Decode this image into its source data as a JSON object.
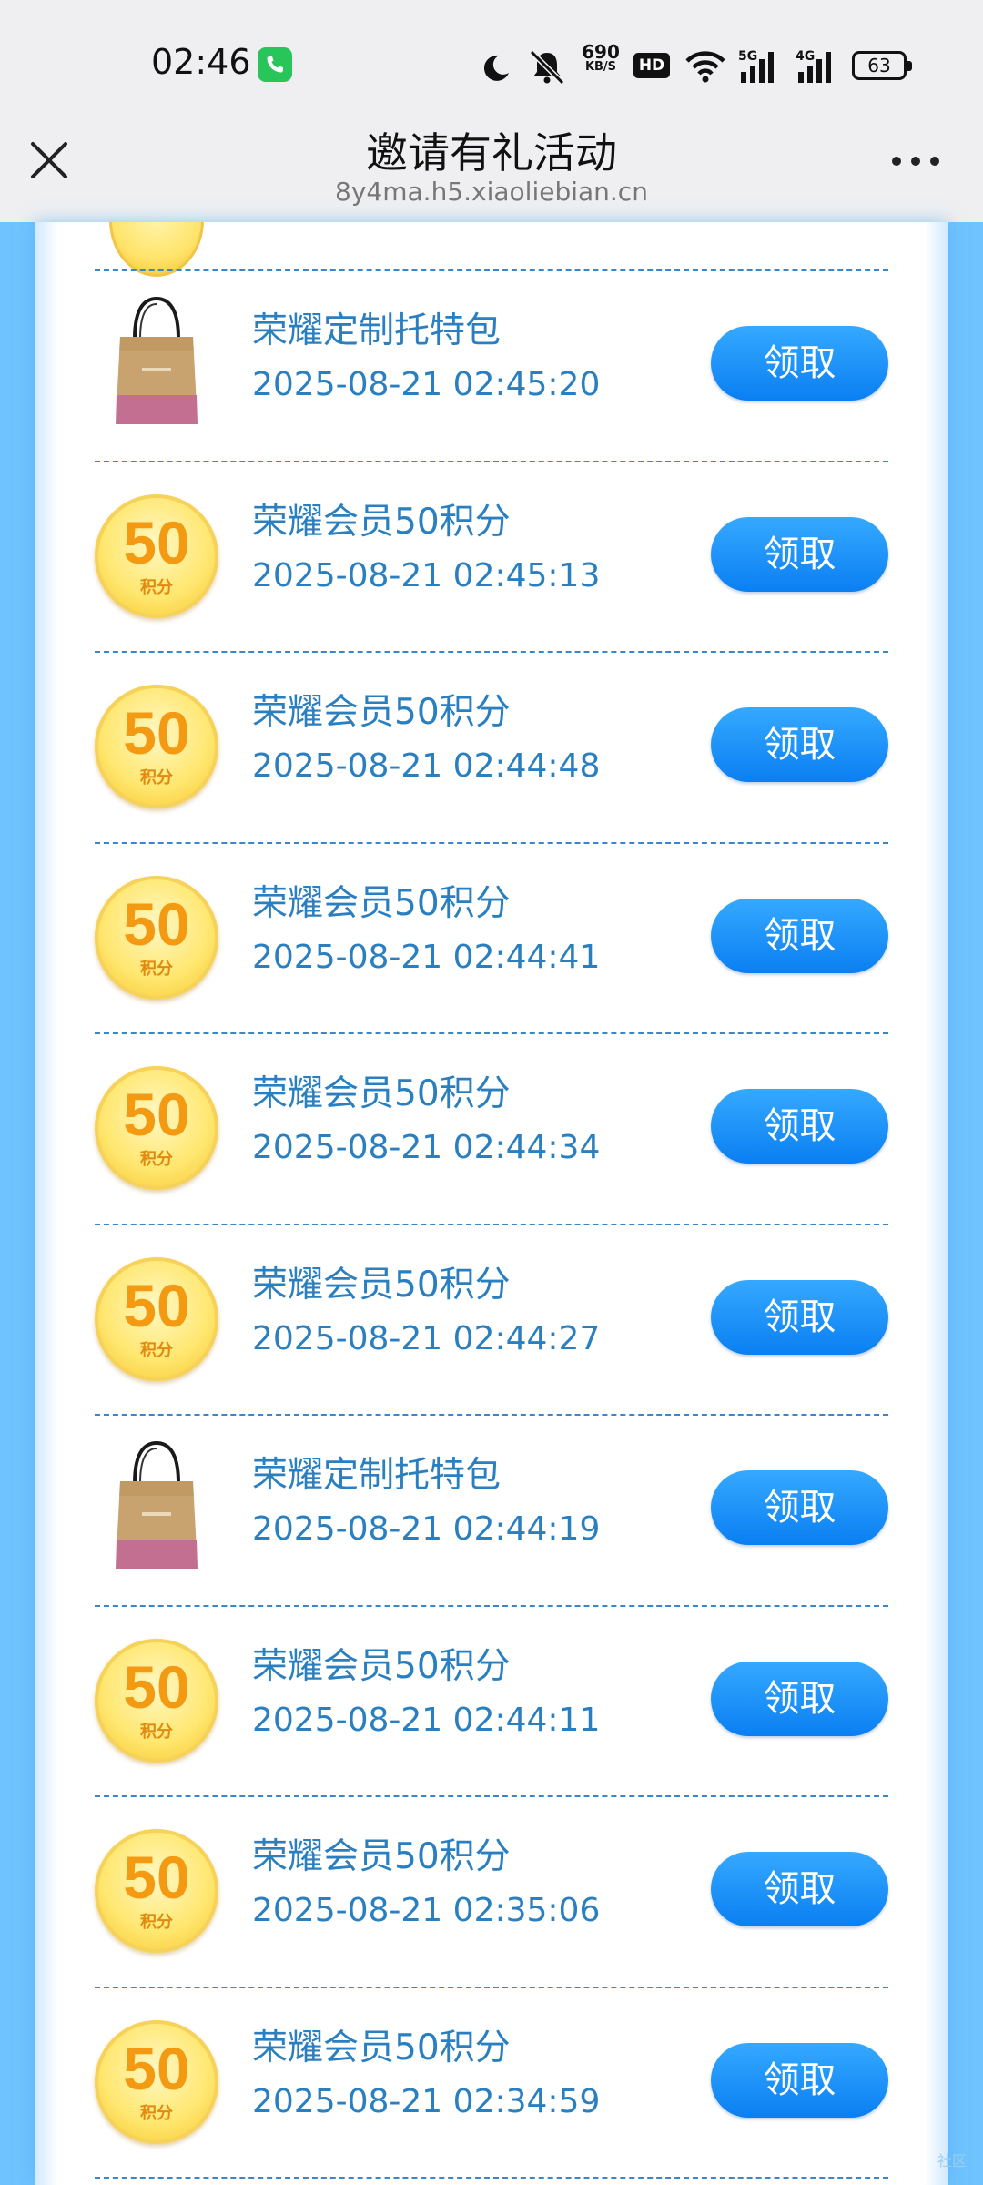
{
  "status_bar": {
    "time": "02:46",
    "net_speed": "690",
    "net_speed_unit": "KB/S",
    "hd_label": "HD",
    "net1": "5G",
    "net2": "4G",
    "battery": "63"
  },
  "header": {
    "title": "邀请有礼活动",
    "url": "8y4ma.h5.xiaoliebian.cn"
  },
  "rewards": [
    {
      "type": "bag",
      "name": "荣耀定制托特包",
      "time": "2025-08-21 02:45:20",
      "button": "领取"
    },
    {
      "type": "coin",
      "name": "荣耀会员50积分",
      "time": "2025-08-21 02:45:13",
      "button": "领取"
    },
    {
      "type": "coin",
      "name": "荣耀会员50积分",
      "time": "2025-08-21 02:44:48",
      "button": "领取"
    },
    {
      "type": "coin",
      "name": "荣耀会员50积分",
      "time": "2025-08-21 02:44:41",
      "button": "领取"
    },
    {
      "type": "coin",
      "name": "荣耀会员50积分",
      "time": "2025-08-21 02:44:34",
      "button": "领取"
    },
    {
      "type": "coin",
      "name": "荣耀会员50积分",
      "time": "2025-08-21 02:44:27",
      "button": "领取"
    },
    {
      "type": "bag",
      "name": "荣耀定制托特包",
      "time": "2025-08-21 02:44:19",
      "button": "领取"
    },
    {
      "type": "coin",
      "name": "荣耀会员50积分",
      "time": "2025-08-21 02:44:11",
      "button": "领取"
    },
    {
      "type": "coin",
      "name": "荣耀会员50积分",
      "time": "2025-08-21 02:35:06",
      "button": "领取"
    },
    {
      "type": "coin",
      "name": "荣耀会员50积分",
      "time": "2025-08-21 02:34:59",
      "button": "领取"
    }
  ],
  "coin_badge": {
    "value": "50",
    "label": "积分"
  },
  "watermark": "社区"
}
